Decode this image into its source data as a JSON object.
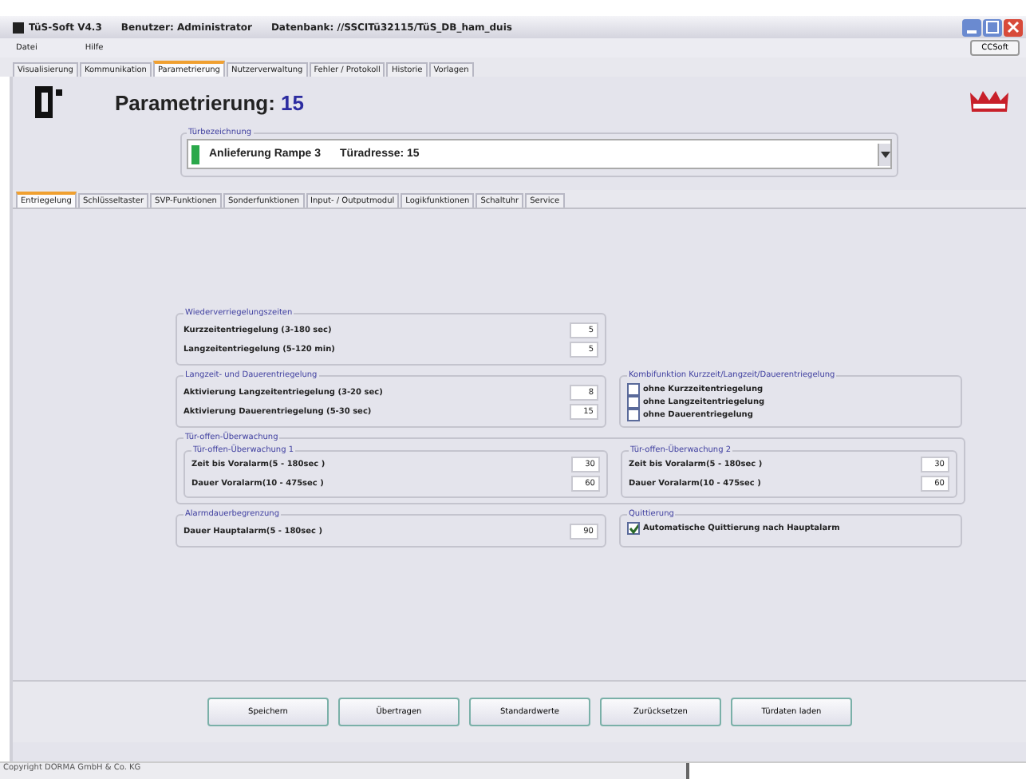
{
  "window": {
    "title": "TüS-Soft V4.3",
    "user": "Benutzer: Administrator",
    "database": "Datenbank: //SSCITü32115/TüS_DB_ham_duis"
  },
  "menu": [
    "Datei",
    "Hilfe"
  ],
  "toolbar_button": "CCSoft",
  "tabs": [
    {
      "label": "Visualisierung",
      "selected": false
    },
    {
      "label": "Kommunikation",
      "selected": false
    },
    {
      "label": "Parametrierung",
      "selected": true
    },
    {
      "label": "Nutzerverwaltung",
      "selected": false
    },
    {
      "label": "Fehler / Protokoll",
      "selected": false
    },
    {
      "label": "Historie",
      "selected": false
    },
    {
      "label": "Vorlagen",
      "selected": false
    }
  ],
  "header": {
    "title": "Parametrierung:",
    "number": "15"
  },
  "door": {
    "legend": "Türbezeichnung",
    "name": "Anlieferung Rampe 3",
    "address": "Türadresse: 15",
    "color": "#2aa84a"
  },
  "subtabs": [
    {
      "label": "Entriegelung",
      "selected": true
    },
    {
      "label": "Schlüsseltaster",
      "selected": false
    },
    {
      "label": "SVP-Funktionen",
      "selected": false
    },
    {
      "label": "Sonderfunktionen",
      "selected": false
    },
    {
      "label": "Input- / Outputmodul",
      "selected": false
    },
    {
      "label": "Logikfunktionen",
      "selected": false
    },
    {
      "label": "Schaltuhr",
      "selected": false
    },
    {
      "label": "Service",
      "selected": false
    }
  ],
  "relock": {
    "legend": "Wiederverriegelungszeiten",
    "fields": [
      {
        "label": "Kurzzeitentriegelung (3-180 sec)",
        "value": "5"
      },
      {
        "label": "Langzeitentriegelung (5-120 min)",
        "value": "5"
      }
    ]
  },
  "long_unlock": {
    "legend": "Langzeit- und Dauerentriegelung",
    "fields": [
      {
        "label": "Aktivierung Langzeitentriegelung (3-20 sec)",
        "value": "8"
      },
      {
        "label": "Aktivierung Dauerentriegelung (5-30 sec)",
        "value": "15"
      }
    ]
  },
  "combi": {
    "legend": "Kombifunktion Kurzzeit/Langzeit/Dauerentriegelung",
    "options": [
      {
        "label": "ohne Kurzzeitentriegelung",
        "checked": false
      },
      {
        "label": "ohne Langzeitentriegelung",
        "checked": false
      },
      {
        "label": "ohne Dauerentriegelung",
        "checked": false
      }
    ]
  },
  "door_open": {
    "legend": "Tür-offen-Überwachung",
    "groups": [
      {
        "legend": "Tür-offen-Überwachung 1",
        "fields": [
          {
            "label": "Zeit bis Voralarm(5 - 180sec )",
            "value": "30"
          },
          {
            "label": "Dauer Voralarm(10 - 475sec )",
            "value": "60"
          }
        ]
      },
      {
        "legend": "Tür-offen-Überwachung 2",
        "fields": [
          {
            "label": "Zeit bis Voralarm(5 - 180sec )",
            "value": "30"
          },
          {
            "label": "Dauer Voralarm(10 - 475sec )",
            "value": "60"
          }
        ]
      }
    ]
  },
  "alarm": {
    "legend": "Alarmdauerbegrenzung",
    "fields": [
      {
        "label": "Dauer Hauptalarm(5 - 180sec )",
        "value": "90"
      }
    ]
  },
  "ack": {
    "legend": "Quittierung",
    "options": [
      {
        "label": "Automatische Quittierung nach Hauptalarm",
        "checked": true
      }
    ]
  },
  "buttons": [
    "Speichern",
    "Übertragen",
    "Standardwerte",
    "Zurücksetzen",
    "Türdaten laden"
  ],
  "status_bar": "Copyright DORMA GmbH & Co. KG"
}
